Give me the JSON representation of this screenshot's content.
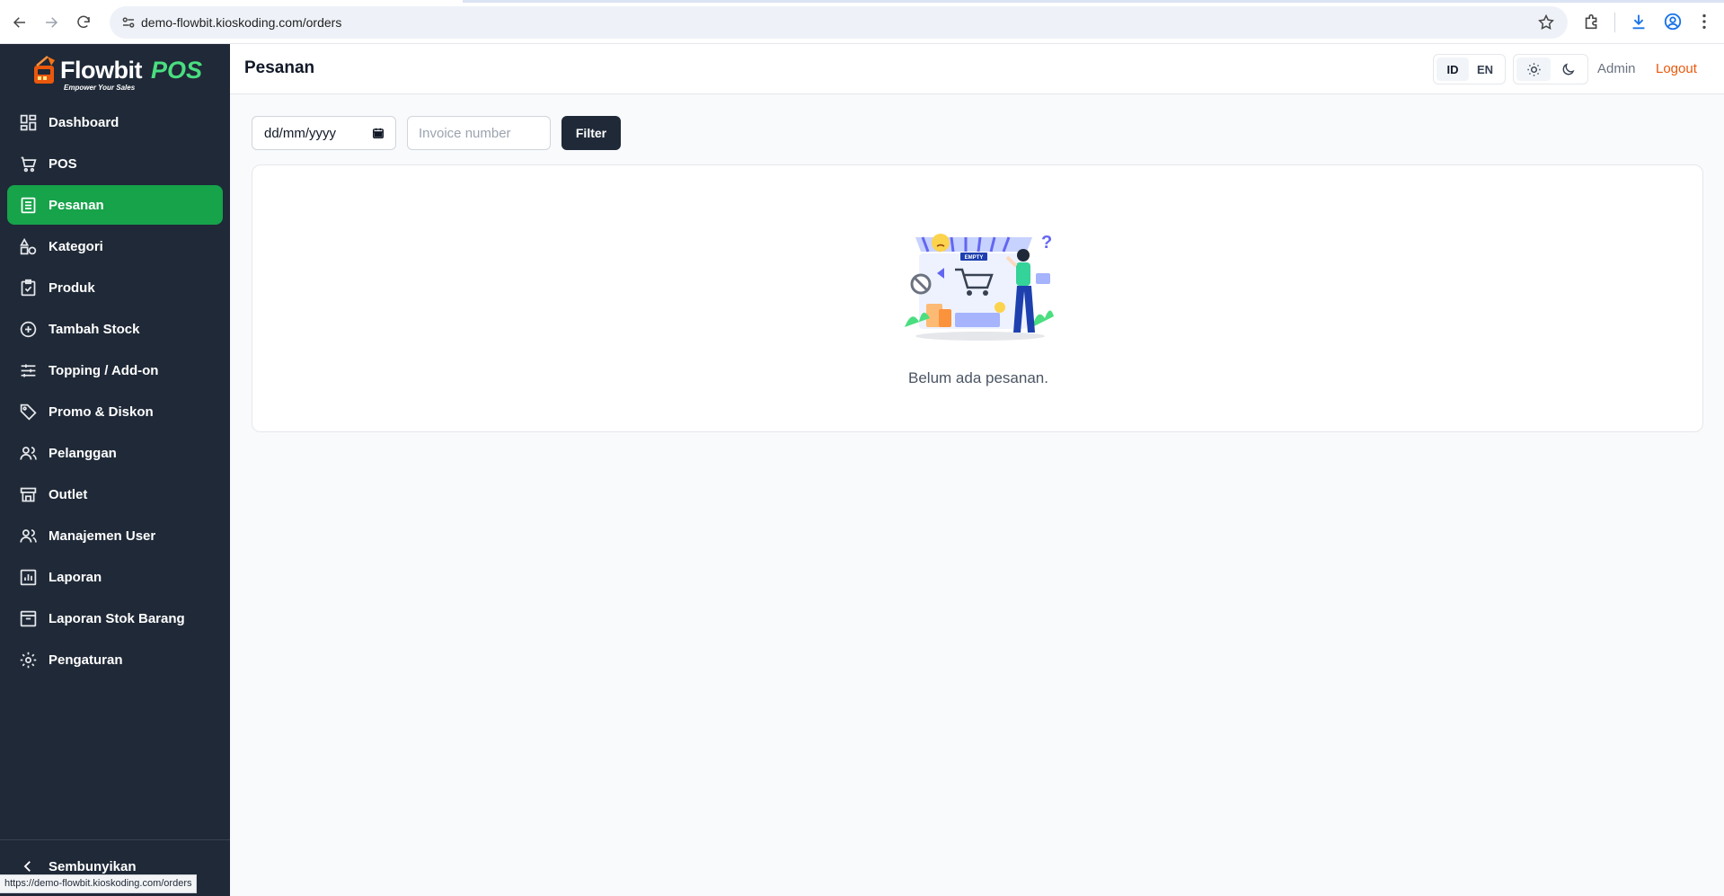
{
  "browser": {
    "url": "demo-flowbit.kioskoding.com/orders",
    "status_url": "https://demo-flowbit.kioskoding.com/orders"
  },
  "brand": {
    "name": "Flowbit",
    "suffix": "POS",
    "tagline": "Empower Your Sales",
    "accent": "#4ade80"
  },
  "sidebar": {
    "active_color": "#16a34a",
    "background": "#1f2937",
    "items": [
      {
        "label": "Dashboard",
        "icon": "dashboard-icon"
      },
      {
        "label": "POS",
        "icon": "cart-icon"
      },
      {
        "label": "Pesanan",
        "icon": "orders-list-icon",
        "active": true
      },
      {
        "label": "Kategori",
        "icon": "category-shapes-icon"
      },
      {
        "label": "Produk",
        "icon": "clipboard-check-icon"
      },
      {
        "label": "Tambah Stock",
        "icon": "plus-circle-icon"
      },
      {
        "label": "Topping / Add-on",
        "icon": "sliders-icon"
      },
      {
        "label": "Promo & Diskon",
        "icon": "tag-icon"
      },
      {
        "label": "Pelanggan",
        "icon": "users-icon"
      },
      {
        "label": "Outlet",
        "icon": "store-icon"
      },
      {
        "label": "Manajemen User",
        "icon": "users-icon"
      },
      {
        "label": "Laporan",
        "icon": "bar-chart-icon"
      },
      {
        "label": "Laporan Stok Barang",
        "icon": "archive-icon"
      },
      {
        "label": "Pengaturan",
        "icon": "gear-icon"
      }
    ],
    "collapse_label": "Sembunyikan"
  },
  "header": {
    "title": "Pesanan",
    "lang_id": "ID",
    "lang_en": "EN",
    "user_label": "Admin",
    "logout_label": "Logout",
    "logout_color": "#ea580c"
  },
  "filters": {
    "date_placeholder": "dd/mm/yyyy",
    "invoice_placeholder": "Invoice number",
    "filter_label": "Filter"
  },
  "empty_state": {
    "illustration_label": "EMPTY",
    "message": "Belum ada pesanan."
  }
}
